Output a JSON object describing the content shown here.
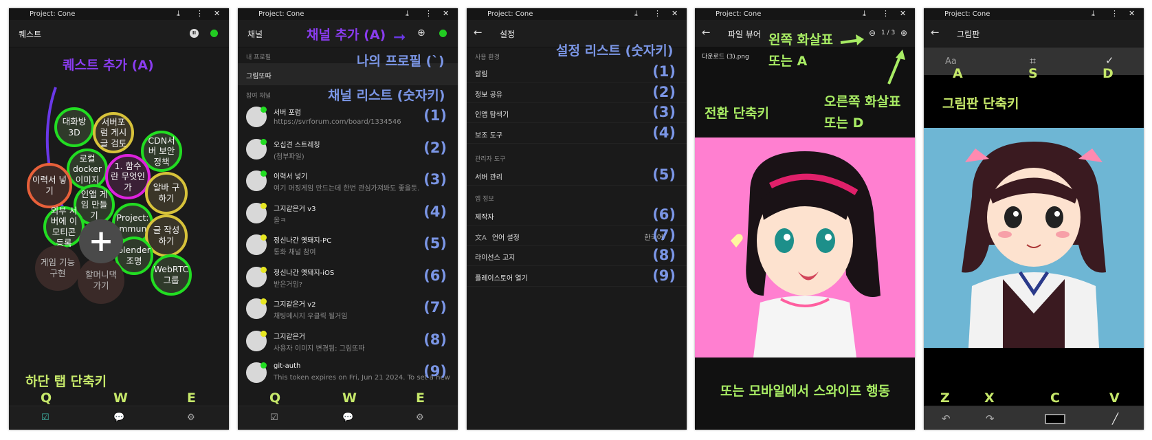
{
  "app_title": "Project: Cone",
  "titlebar_icons": [
    "download-icon",
    "more-icon",
    "close-icon"
  ],
  "colors": {
    "annotation_purple": "#8a3cf0",
    "annotation_blue": "#7b96e6",
    "annotation_green": "#a8ec64",
    "status_green": "#22cc22",
    "bubble_green": "#22dd22",
    "bubble_magenta": "#dd22dd",
    "bubble_orange": "#e8603a",
    "bubble_yellow": "#d7c23a"
  },
  "panel1": {
    "header": "퀘스트",
    "annotation_add": "퀘스트 추가 (A)",
    "annotation_tabs": "하단 탭 단축키",
    "keys": [
      "Q",
      "W",
      "E"
    ],
    "quests": [
      {
        "label": "대화방 3D",
        "ring": "green"
      },
      {
        "label": "서버포럼 게시글 검토",
        "ring": "yellow"
      },
      {
        "label": "CDN서버 보안 정책",
        "ring": "green"
      },
      {
        "label": "로컬 docker 이미지",
        "ring": "green"
      },
      {
        "label": "1. 함수란 무엇인가",
        "ring": "magenta"
      },
      {
        "label": "이력서 넣기",
        "ring": "orange"
      },
      {
        "label": "알바 구하기",
        "ring": "yellow"
      },
      {
        "label": "인앱 게임 만들기",
        "ring": "green"
      },
      {
        "label": "Project: Community",
        "ring": "green"
      },
      {
        "label": "외부 서버에 이모티콘 등록",
        "ring": "green"
      },
      {
        "label": "글 작성하기",
        "ring": "yellow"
      },
      {
        "label": "blender 조명",
        "ring": "green"
      },
      {
        "label": "게임 기능 구현",
        "ring": "none"
      },
      {
        "label": "WebRTC 그룹",
        "ring": "green"
      },
      {
        "label": "할머니댁 가기",
        "ring": "none"
      }
    ],
    "add_button": "+"
  },
  "panel2": {
    "header": "채널",
    "annotation_add": "채널 추가 (A)",
    "annotation_profile": "나의 프로필 (`)",
    "annotation_list": "채널 리스트 (숫자키)",
    "section_profile": "내 프로필",
    "profile_name": "그림또따",
    "section_channels": "참여 채널",
    "channels": [
      {
        "name": "서버 포럼",
        "msg": "https://svrforum.com/board/1334546",
        "num": "(1)",
        "status": "green"
      },
      {
        "name": "오십견 스트레칭",
        "msg": "(첨부파일)",
        "num": "(2)",
        "status": "green"
      },
      {
        "name": "이력서 넣기",
        "msg": "여기 머징게임 만드는데 한번 관심가져봐도 좋을듯.",
        "num": "(3)",
        "status": "green"
      },
      {
        "name": "그지같은거 v3",
        "msg": "올ㅋ",
        "num": "(4)",
        "status": "yellow"
      },
      {
        "name": "정신나간 옛돼지-PC",
        "msg": "통화 채널 참여",
        "num": "(5)",
        "status": "yellow"
      },
      {
        "name": "정신나간 옛돼지-iOS",
        "msg": "받은거임?",
        "num": "(6)",
        "status": "yellow"
      },
      {
        "name": "그지같은거 v2",
        "msg": "채팅메시지 우클릭 될거임",
        "num": "(7)",
        "status": "yellow"
      },
      {
        "name": "그지같은거",
        "msg": "사용자 이미지 변경됨: 그림또따",
        "num": "(8)",
        "status": "yellow"
      },
      {
        "name": "git-auth",
        "msg": "This token expires on Fri, Jun 21 2024. To set a new",
        "num": "(9)",
        "status": "green"
      }
    ],
    "keys": [
      "Q",
      "W",
      "E"
    ]
  },
  "panel3": {
    "header": "설정",
    "annotation_list": "설정 리스트 (숫자키)",
    "section_env": "사용 환경",
    "section_admin": "관리자 도구",
    "section_info": "앱 정보",
    "items_env": [
      {
        "label": "알림",
        "num": "(1)"
      },
      {
        "label": "정보 공유",
        "num": "(2)"
      },
      {
        "label": "인앱 탐색기",
        "num": "(3)"
      },
      {
        "label": "보조 도구",
        "num": "(4)"
      }
    ],
    "items_admin": [
      {
        "label": "서버 관리",
        "num": "(5)"
      }
    ],
    "items_info": [
      {
        "label": "제작자",
        "num": "(6)"
      },
      {
        "label": "언어 설정",
        "num": "(7)",
        "value": "한국어"
      },
      {
        "label": "라이선스 고지",
        "num": "(8)"
      },
      {
        "label": "플레이스토어 열기",
        "num": "(9)"
      }
    ]
  },
  "panel4": {
    "header": "파일 뷰어",
    "page_indicator": "1 / 3",
    "filename": "다운로드 (3).png",
    "annotation_left_1": "왼쪽 화살표",
    "annotation_left_2": "또는 A",
    "annotation_right_1": "오른쪽 화살표",
    "annotation_right_2": "또는 D",
    "annotation_switch": "전환 단축키",
    "annotation_swipe": "또는 모바일에서 스와이프 행동"
  },
  "panel5": {
    "header": "그림판",
    "annotation_title": "그림판 단축키",
    "top_keys": [
      "A",
      "S",
      "D"
    ],
    "bottom_keys": [
      "Z",
      "X",
      "C",
      "V"
    ],
    "tool_text": "Aa"
  }
}
